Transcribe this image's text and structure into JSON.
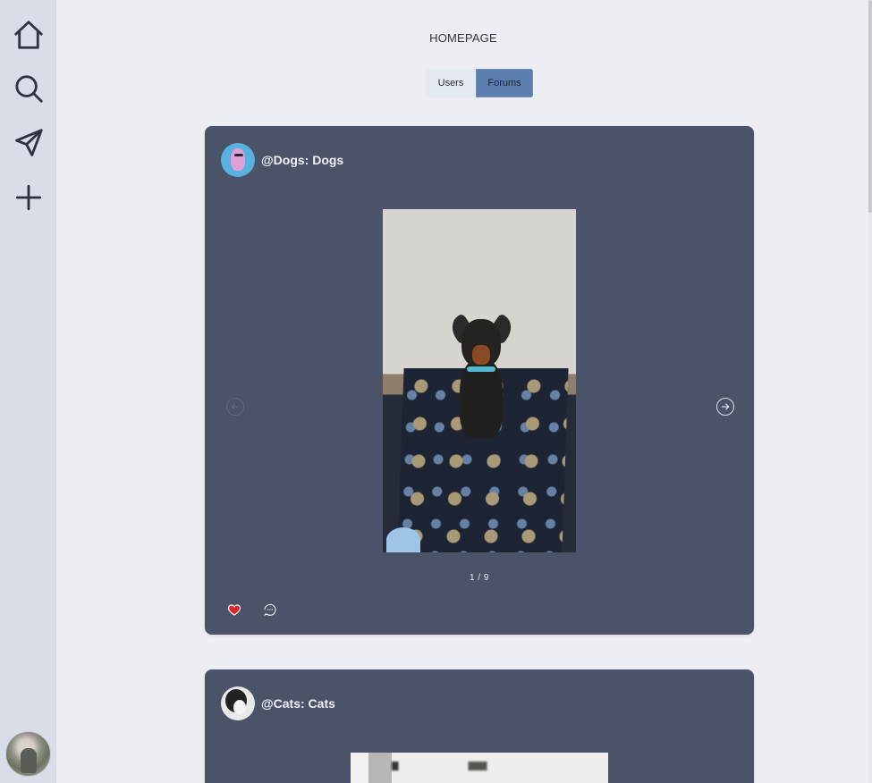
{
  "page": {
    "title": "HOMEPAGE"
  },
  "toggle": {
    "users_label": "Users",
    "forums_label": "Forums",
    "selected": "Forums"
  },
  "sidebar": {
    "items": [
      {
        "name": "home",
        "icon": "home-icon"
      },
      {
        "name": "search",
        "icon": "search-icon"
      },
      {
        "name": "messages",
        "icon": "send-icon"
      },
      {
        "name": "create",
        "icon": "plus-icon"
      }
    ],
    "profile_icon": "avatar"
  },
  "posts": [
    {
      "forum": "@Dogs: Dogs",
      "counter": "1 / 9",
      "liked": true,
      "like_color": "#e4202b"
    },
    {
      "forum": "@Cats: Cats"
    }
  ],
  "colors": {
    "background": "#eceef4",
    "sidebar": "#d8dde8",
    "card": "#4a5367",
    "accent": "#5d7fb0"
  }
}
